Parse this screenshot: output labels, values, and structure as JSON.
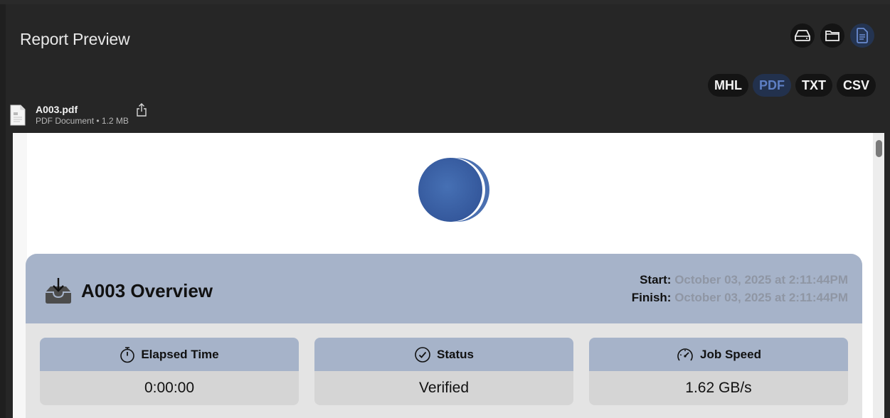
{
  "window": {
    "title": "Report Preview"
  },
  "view_buttons": [
    {
      "icon": "drive-icon"
    },
    {
      "icon": "folder-icon"
    },
    {
      "icon": "document-icon",
      "active": true
    }
  ],
  "formats": [
    {
      "label": "MHL",
      "active": false
    },
    {
      "label": "PDF",
      "active": true
    },
    {
      "label": "TXT",
      "active": false
    },
    {
      "label": "CSV",
      "active": false
    }
  ],
  "file": {
    "name": "A003.pdf",
    "meta": "PDF Document • 1.2 MB"
  },
  "report": {
    "overview_title": "A003 Overview",
    "start_label": "Start:",
    "start_value": "October 03, 2025 at 2:11:44PM",
    "finish_label": "Finish:",
    "finish_value": "October 03, 2025 at 2:11:44PM",
    "stats": [
      {
        "label": "Elapsed Time",
        "value": "0:00:00",
        "icon": "stopwatch-icon"
      },
      {
        "label": "Status",
        "value": "Verified",
        "icon": "checkmark-circle-icon"
      },
      {
        "label": "Job Speed",
        "value": "1.62 GB/s",
        "icon": "speedometer-icon"
      }
    ]
  },
  "colors": {
    "accent": "#5e7fc4",
    "header_band": "#a6b3c9",
    "logo": "#3f64a8"
  }
}
